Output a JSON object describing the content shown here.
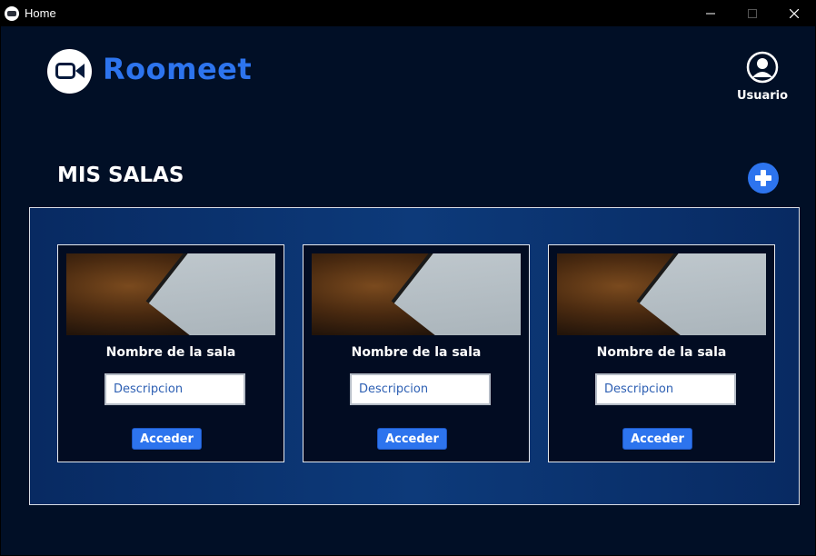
{
  "window": {
    "title": "Home"
  },
  "header": {
    "brand": "Roomeet",
    "user_label": "Usuario"
  },
  "section": {
    "title": "MIS SALAS"
  },
  "rooms": [
    {
      "name": "Nombre de la sala",
      "description_placeholder": "Descripcion",
      "access_label": "Acceder"
    },
    {
      "name": "Nombre de la sala",
      "description_placeholder": "Descripcion",
      "access_label": "Acceder"
    },
    {
      "name": "Nombre de la sala",
      "description_placeholder": "Descripcion",
      "access_label": "Acceder"
    }
  ],
  "colors": {
    "accent": "#2d74ee",
    "background": "#010f26",
    "panel": "#0a3370"
  }
}
